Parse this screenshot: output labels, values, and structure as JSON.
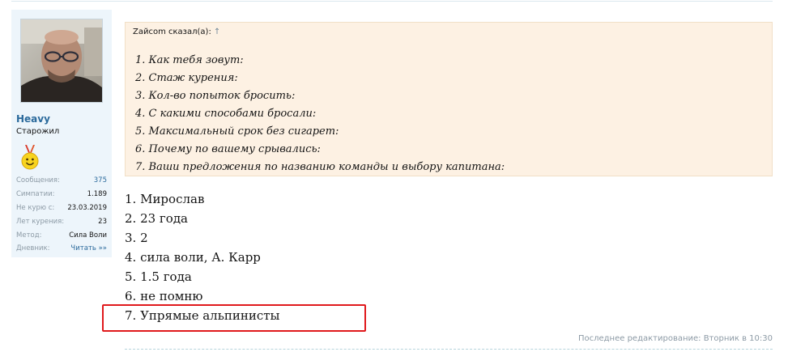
{
  "user": {
    "name": "Heavy",
    "title": "Старожил",
    "avatar_icon": "user-photo-avatar",
    "award_icon": "smiley-medal-icon",
    "stats": [
      {
        "key": "Сообщения:",
        "value": "375"
      },
      {
        "key": "Симпатии:",
        "value": "1.189"
      },
      {
        "key": "Не курю с:",
        "value": "23.03.2019"
      },
      {
        "key": "Лет курения:",
        "value": "23"
      },
      {
        "key": "Метод:",
        "value": "Сила Воли"
      },
      {
        "key": "Дневник:",
        "value": "Читать »»"
      }
    ]
  },
  "quote": {
    "header": "Zайcom сказал(а):",
    "arrow": "↑",
    "lines": [
      "1. Как тебя зовут:",
      "2. Стаж курения:",
      "3. Кол-во попыток бросить:",
      "4. С какими способами бросали:",
      "5. Максимальный срок без сигарет:",
      "6. Почему по вашему срывались:",
      "7. Ваши предложения по названию команды и выбору капитана:"
    ]
  },
  "reply": {
    "lines": [
      "1. Мирослав",
      "2. 23 года",
      "3. 2",
      "4. сила воли, А. Карр",
      "5. 1.5 года",
      "6. не помню",
      "7. Упрямые альпинисты"
    ]
  },
  "edit_note": "Последнее редактирование: Вторник в 10:30",
  "colors": {
    "highlight": "#e0191c",
    "username": "#2b6a9c",
    "quote_bg": "#fdf1e3",
    "sidebar_bg": "#edf5fb"
  }
}
